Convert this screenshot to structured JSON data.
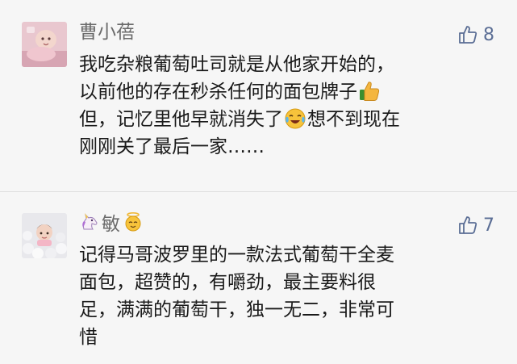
{
  "comments": [
    {
      "author": "曹小蓓",
      "likes": "8",
      "avatar_icon": "baby-photo-avatar",
      "lines": [
        {
          "text": "我吃杂粮葡萄吐司就是从他家开始的，"
        },
        {
          "text": "以前他的存在秒杀任何的面包牌子",
          "emoji_after": "thumbs-up-emoji"
        },
        {
          "text_before": "但，记忆里他早就消失了",
          "emoji": "crying-laughing-emoji",
          "text_after": "想不到现在"
        },
        {
          "text": "刚刚关了最后一家……"
        }
      ]
    },
    {
      "author": "敏",
      "author_prefix_emoji": "unicorn-emoji",
      "author_suffix_emoji": "angel-emoji",
      "likes": "7",
      "avatar_icon": "child-in-ball-pit-avatar",
      "lines": [
        {
          "text": "记得马哥波罗里的一款法式葡萄干全麦"
        },
        {
          "text": "面包，超赞的，有嚼劲，最主要料很"
        },
        {
          "text": "足，满满的葡萄干，独一无二，非常可"
        },
        {
          "text": "惜"
        }
      ]
    }
  ],
  "colors": {
    "background": "#f6f6f6",
    "name": "#6b6b6b",
    "text": "#1a1a1a",
    "like": "#5b6e95"
  }
}
